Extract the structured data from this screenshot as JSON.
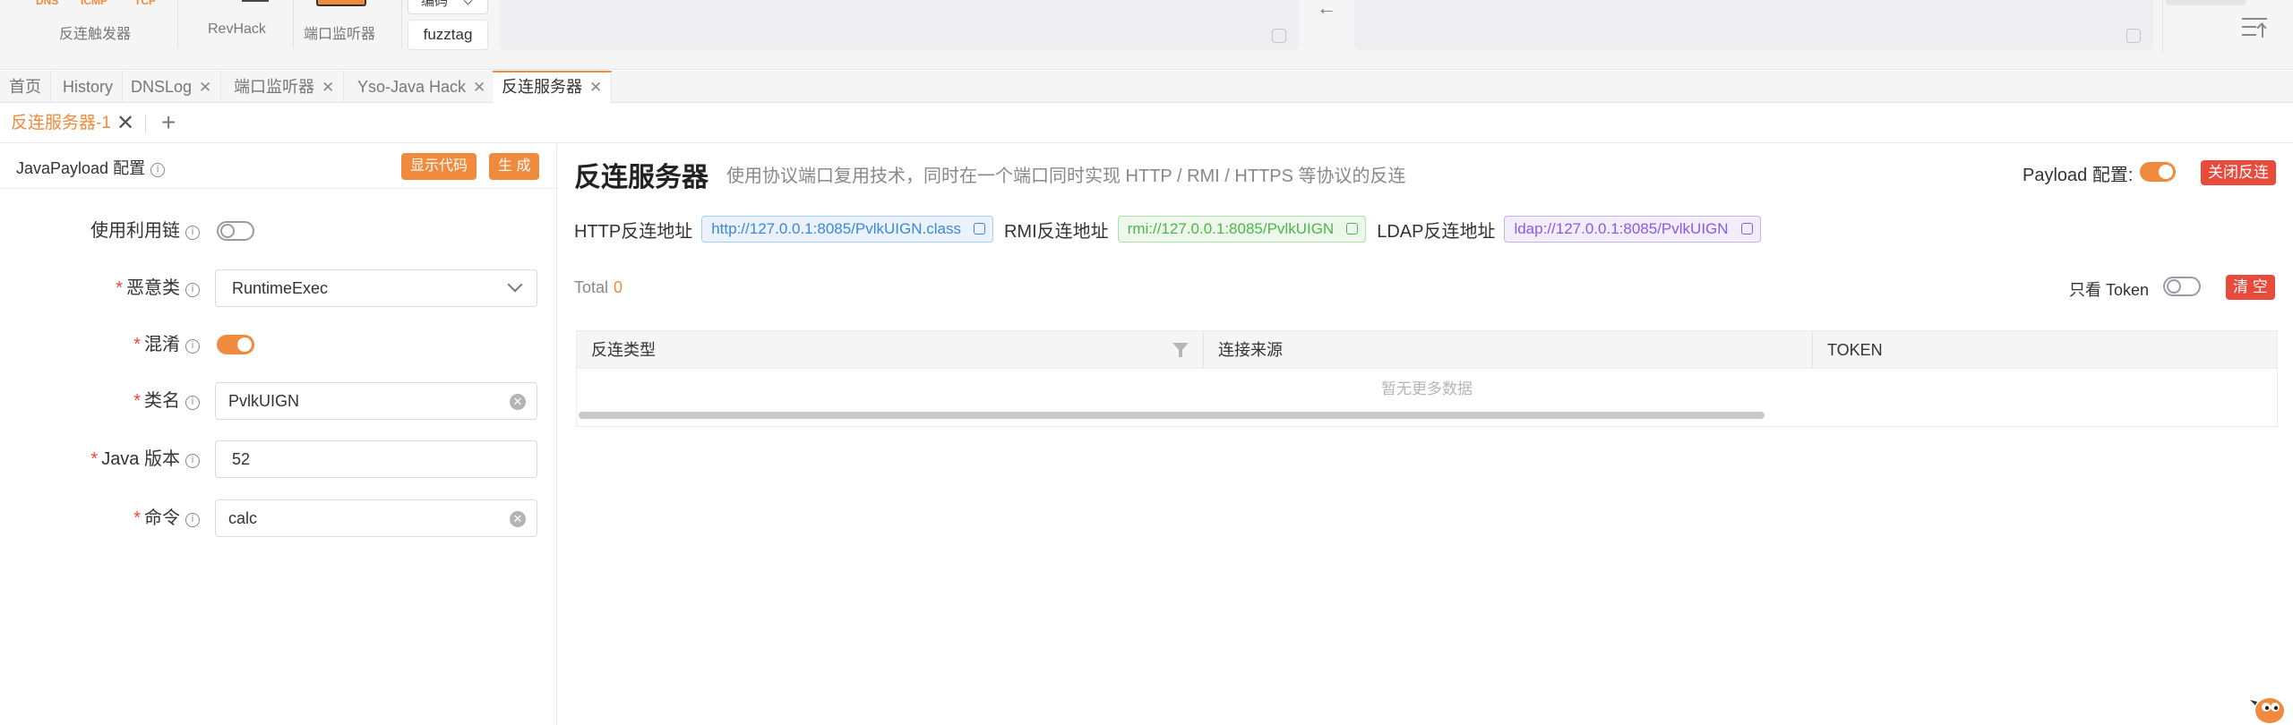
{
  "toolbar": {
    "tiny_labels": [
      "DNS",
      "ICMP",
      "TCP"
    ],
    "groups": [
      {
        "caption": "反连触发器"
      },
      {
        "caption": "RevHack"
      },
      {
        "caption": "端口监听器"
      }
    ],
    "dropdown_label": "编码",
    "fuzztag_label": "fuzztag",
    "arrow": "←"
  },
  "tabs": [
    {
      "label": "首页",
      "closable": false
    },
    {
      "label": "History",
      "closable": false
    },
    {
      "label": "DNSLog",
      "closable": true
    },
    {
      "label": "端口监听器",
      "closable": true
    },
    {
      "label": "Yso-Java Hack",
      "closable": true
    },
    {
      "label": "反连服务器",
      "closable": true,
      "active": true
    }
  ],
  "subtab": {
    "label": "反连服务器-1",
    "close": "✕",
    "add": "+"
  },
  "left": {
    "title": "JavaPayload 配置",
    "show_code_btn": "显示代码",
    "generate_btn": "生 成",
    "fields": {
      "use_chain": {
        "label": "使用利用链",
        "toggle": false
      },
      "evil_class": {
        "label": "恶意类",
        "value": "RuntimeExec"
      },
      "obfuscate": {
        "label": "混淆",
        "toggle": true
      },
      "class_name": {
        "label": "类名",
        "value": "PvlkUIGN"
      },
      "java_version": {
        "label": "Java 版本",
        "value": "52"
      },
      "command": {
        "label": "命令",
        "value": "calc"
      }
    }
  },
  "right": {
    "title": "反连服务器",
    "desc": "使用协议端口复用技术，同时在一个端口同时实现 HTTP / RMI / HTTPS 等协议的反连",
    "payload_config_label": "Payload 配置:",
    "payload_config_on": true,
    "close_reverse_btn": "关闭反连",
    "http_label": "HTTP反连地址",
    "http_addr": "http://127.0.0.1:8085/PvlkUIGN.class",
    "rmi_label": "RMI反连地址",
    "rmi_addr": "rmi://127.0.0.1:8085/PvlkUIGN",
    "ldap_label": "LDAP反连地址",
    "ldap_addr": "ldap://127.0.0.1:8085/PvlkUIGN",
    "total_label": "Total",
    "total_value": "0",
    "token_only_label": "只看 Token",
    "token_only_on": false,
    "clear_btn": "清 空",
    "columns": [
      "反连类型",
      "连接来源",
      "TOKEN"
    ],
    "empty_text": "暂无更多数据"
  },
  "colors": {
    "accent": "#f08a3c",
    "danger": "#e84a3c"
  }
}
